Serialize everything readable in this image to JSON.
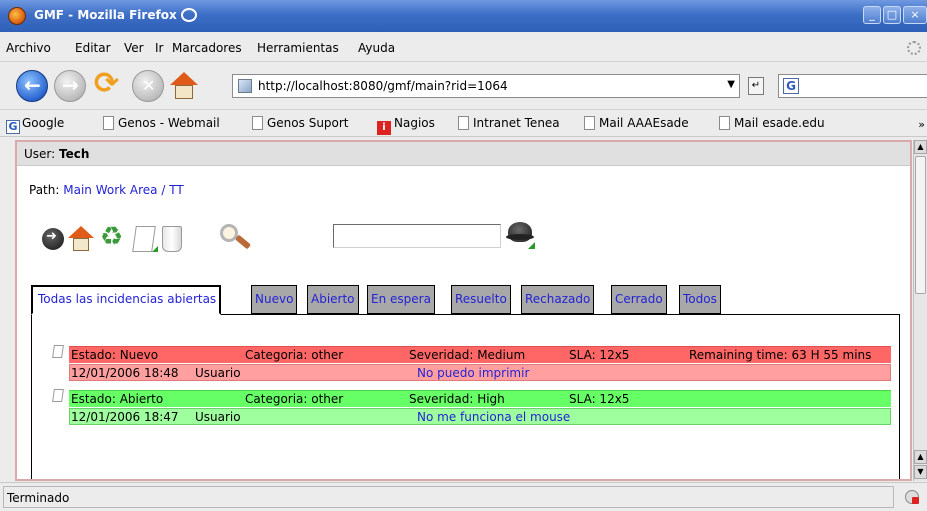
{
  "window": {
    "title": "GMF - Mozilla Firefox",
    "minimize": "_",
    "restore": "□",
    "close": "×"
  },
  "menu": {
    "items": [
      "Archivo",
      "Editar",
      "Ver",
      "Ir",
      "Marcadores",
      "Herramientas",
      "Ayuda"
    ]
  },
  "navigation": {
    "url": "http://localhost:8080/gmf/main?rid=1064",
    "dropdown_glyph": "▼",
    "go_glyph": "↵",
    "search_engine_glyph": "G"
  },
  "bookmarks": {
    "items": [
      "Google",
      "Genos - Webmail",
      "Genos Suport",
      "Nagios",
      "Intranet Tenea",
      "Mail AAAEsade",
      "Mail esade.edu"
    ],
    "more_glyph": "»"
  },
  "page": {
    "user_label": "User:",
    "user_name": "Tech",
    "path_label": "Path:",
    "path_items": [
      "Main Work Area",
      "/",
      "TT"
    ],
    "search_value": ""
  },
  "tabs": {
    "items": [
      "Todas las incidencias abiertas",
      "Nuevo",
      "Abierto",
      "En espera",
      "Resuelto",
      "Rechazado",
      "Cerrado",
      "Todos"
    ],
    "active_index": 0
  },
  "incidents": [
    {
      "estado": "Estado: Nuevo",
      "categoria": "Categoria: other",
      "severidad": "Severidad: Medium",
      "sla": "SLA: 12x5",
      "remaining": "Remaining time: 63 H 55 mins",
      "datetime": "12/01/2006 18:48",
      "user": "Usuario",
      "summary": "No puedo imprimir",
      "color_head": "#ff6666",
      "color_body": "#ff9f9f"
    },
    {
      "estado": "Estado: Abierto",
      "categoria": "Categoria: other",
      "severidad": "Severidad: High",
      "sla": "SLA: 12x5",
      "remaining": "",
      "datetime": "12/01/2006 18:47",
      "user": "Usuario",
      "summary": "No me funciona el mouse",
      "color_head": "#66ff66",
      "color_body": "#9fff9f"
    }
  ],
  "status": {
    "text": "Terminado"
  }
}
